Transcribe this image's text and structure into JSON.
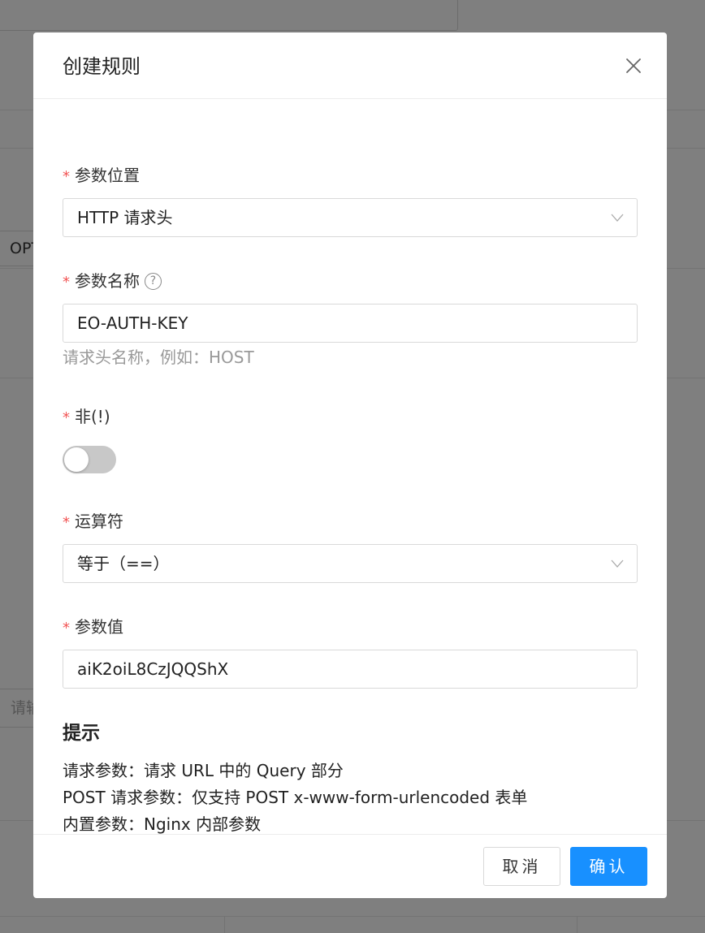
{
  "background": {
    "opt_text": "OPT",
    "input_placeholder": "请输"
  },
  "modal": {
    "title": "创建规则",
    "fields": {
      "param_location": {
        "required_mark": "*",
        "label": "参数位置",
        "value": "HTTP 请求头"
      },
      "param_name": {
        "required_mark": "*",
        "label": "参数名称",
        "help_glyph": "?",
        "value": "EO-AUTH-KEY",
        "hint": "请求头名称，例如：HOST"
      },
      "not": {
        "required_mark": "*",
        "label": "非(!)",
        "enabled": false
      },
      "operator": {
        "required_mark": "*",
        "label": "运算符",
        "value": "等于（==）"
      },
      "param_value": {
        "required_mark": "*",
        "label": "参数值",
        "value": "aiK2oiL8CzJQQShX"
      }
    },
    "tips": {
      "title": "提示",
      "lines": [
        "请求参数：请求 URL 中的 Query 部分",
        "POST 请求参数：仅支持 POST x-www-form-urlencoded 表单",
        "内置参数：Nginx 内部参数"
      ]
    },
    "footer": {
      "cancel_label": "取消",
      "ok_label": "确认"
    }
  },
  "colors": {
    "primary": "#1890ff",
    "required": "#f25555",
    "overlay": "rgba(0,0,0,0.5)"
  }
}
